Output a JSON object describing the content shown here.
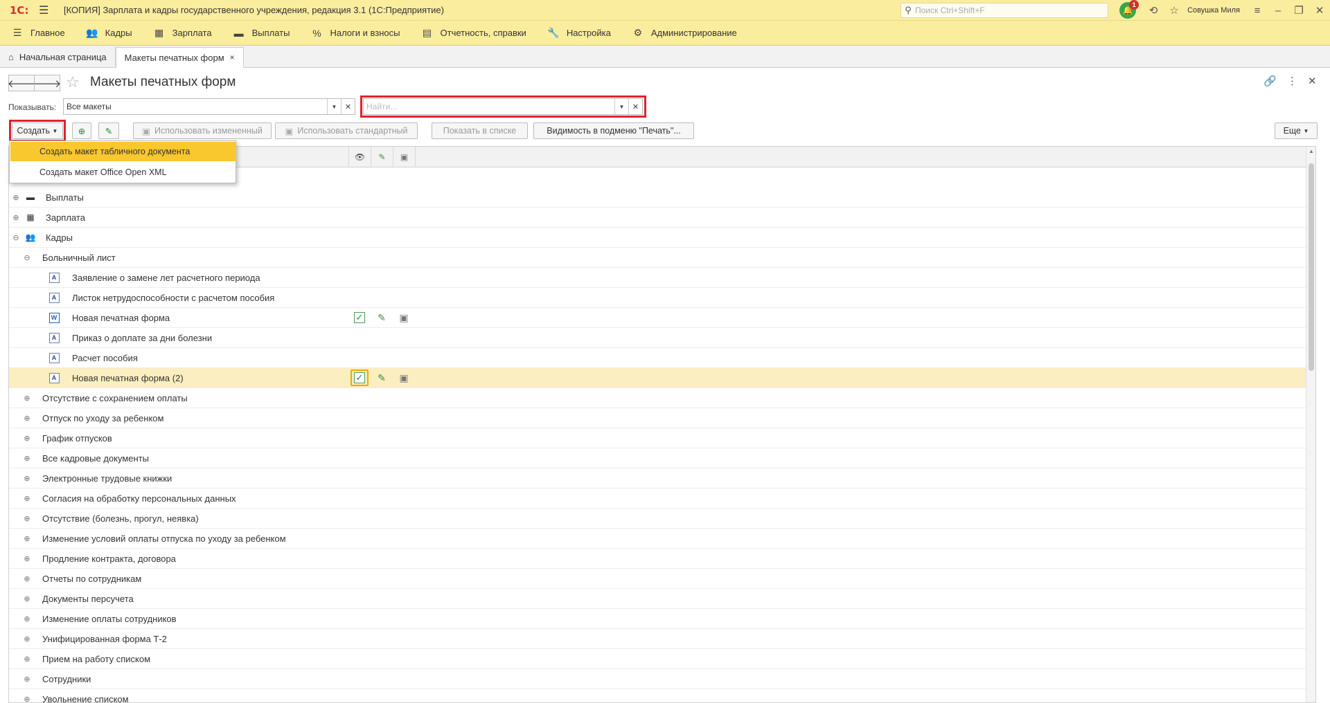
{
  "window": {
    "logo": "1С:",
    "title": "[КОПИЯ] Зарплата и кадры государственного учреждения, редакция 3.1  (1С:Предприятие)",
    "search_placeholder": "Поиск Ctrl+Shift+F",
    "notifications_count": "1",
    "user": "Совушка Миля"
  },
  "main_menu": [
    {
      "label": "Главное",
      "icon": "menu-lines-icon"
    },
    {
      "label": "Кадры",
      "icon": "people-icon"
    },
    {
      "label": "Зарплата",
      "icon": "calculator-icon"
    },
    {
      "label": "Выплаты",
      "icon": "wallet-icon"
    },
    {
      "label": "Налоги и взносы",
      "icon": "percent-icon"
    },
    {
      "label": "Отчетность, справки",
      "icon": "reports-icon"
    },
    {
      "label": "Настройка",
      "icon": "wrench-icon"
    },
    {
      "label": "Администрирование",
      "icon": "gear-icon"
    }
  ],
  "tabs": [
    {
      "label": "Начальная страница",
      "icon": "home-icon"
    },
    {
      "label": "Макеты печатных форм",
      "close": "×"
    }
  ],
  "page": {
    "title": "Макеты печатных форм"
  },
  "filter": {
    "show_label": "Показывать:",
    "show_value": "Все макеты",
    "search_placeholder": "Найти..."
  },
  "toolbar": {
    "create": "Создать",
    "use_modified": "Использовать измененный",
    "use_standard": "Использовать стандартный",
    "show_in_list": "Показать в списке",
    "visibility": "Видимость в подменю \"Печать\"...",
    "more": "Еще"
  },
  "create_menu": [
    "Создать макет табличного документа",
    "Создать макет Office Open XML"
  ],
  "rows": [
    {
      "level": 0,
      "expander": "⊕",
      "icon": "wallet-icon",
      "text": "Выплаты"
    },
    {
      "level": 0,
      "expander": "⊕",
      "icon": "calculator-icon",
      "text": "Зарплата"
    },
    {
      "level": 0,
      "expander": "⊖",
      "icon": "people-icon",
      "text": "Кадры"
    },
    {
      "level": 1,
      "expander": "⊖",
      "icon": "",
      "text": "Больничный лист"
    },
    {
      "level": 2,
      "expander": "",
      "icon": "spreadsheet-template-icon",
      "text": "Заявление о замене лет расчетного периода"
    },
    {
      "level": 2,
      "expander": "",
      "icon": "spreadsheet-template-icon",
      "text": "Листок нетрудоспособности с расчетом пособия"
    },
    {
      "level": 2,
      "expander": "",
      "icon": "word-template-icon",
      "text": "Новая печатная форма",
      "checked": true
    },
    {
      "level": 2,
      "expander": "",
      "icon": "spreadsheet-template-icon",
      "text": "Приказ о доплате за дни болезни"
    },
    {
      "level": 2,
      "expander": "",
      "icon": "spreadsheet-template-icon",
      "text": "Расчет пособия"
    },
    {
      "level": 2,
      "expander": "",
      "icon": "spreadsheet-template-icon",
      "text": "Новая печатная форма (2)",
      "checked": true,
      "selected": true
    },
    {
      "level": 1,
      "expander": "⊕",
      "icon": "",
      "text": "Отсутствие с сохранением оплаты"
    },
    {
      "level": 1,
      "expander": "⊕",
      "icon": "",
      "text": "Отпуск по уходу за ребенком"
    },
    {
      "level": 1,
      "expander": "⊕",
      "icon": "",
      "text": "График отпусков"
    },
    {
      "level": 1,
      "expander": "⊕",
      "icon": "",
      "text": "Все кадровые документы"
    },
    {
      "level": 1,
      "expander": "⊕",
      "icon": "",
      "text": "Электронные трудовые книжки"
    },
    {
      "level": 1,
      "expander": "⊕",
      "icon": "",
      "text": "Согласия на обработку персональных данных"
    },
    {
      "level": 1,
      "expander": "⊕",
      "icon": "",
      "text": "Отсутствие (болезнь, прогул, неявка)"
    },
    {
      "level": 1,
      "expander": "⊕",
      "icon": "",
      "text": "Изменение условий оплаты отпуска по уходу за ребенком"
    },
    {
      "level": 1,
      "expander": "⊕",
      "icon": "",
      "text": "Продление контракта, договора"
    },
    {
      "level": 1,
      "expander": "⊕",
      "icon": "",
      "text": "Отчеты по сотрудникам"
    },
    {
      "level": 1,
      "expander": "⊕",
      "icon": "",
      "text": "Документы персучета"
    },
    {
      "level": 1,
      "expander": "⊕",
      "icon": "",
      "text": "Изменение оплаты сотрудников"
    },
    {
      "level": 1,
      "expander": "⊕",
      "icon": "",
      "text": "Унифицированная форма Т-2"
    },
    {
      "level": 1,
      "expander": "⊕",
      "icon": "",
      "text": "Прием на работу списком"
    },
    {
      "level": 1,
      "expander": "⊕",
      "icon": "",
      "text": "Сотрудники"
    },
    {
      "level": 1,
      "expander": "⊕",
      "icon": "",
      "text": "Увольнение списком"
    }
  ],
  "colors": {
    "accent_bar": "#fbed9e",
    "highlight_red": "#e0222d",
    "menu_highlight": "#f9c72e",
    "selected_row": "#fbeec0"
  }
}
